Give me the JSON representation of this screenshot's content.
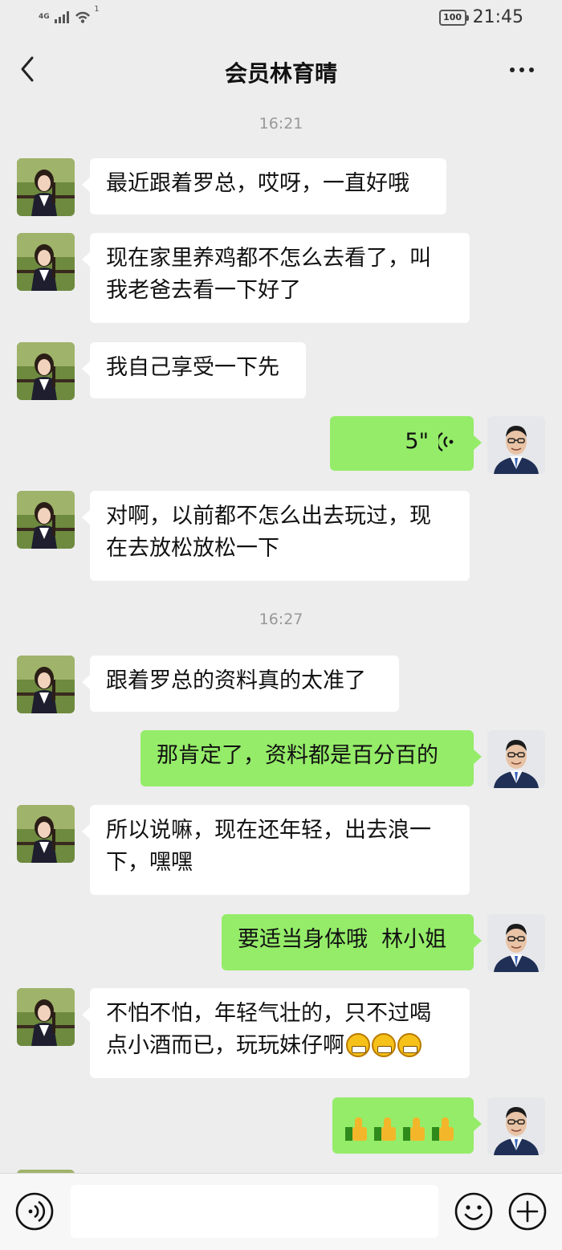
{
  "status_bar": {
    "network": "4G",
    "wifi_sup": "1",
    "battery": "100",
    "time": "21:45"
  },
  "header": {
    "title": "会员林育晴"
  },
  "timestamps": [
    "16:21",
    "16:27"
  ],
  "messages": [
    {
      "from": "other",
      "text": "最近跟着罗总，哎呀，一直好哦"
    },
    {
      "from": "other",
      "lines": [
        "现在家里养鸡都不怎么去看了，叫",
        "我老爸去看一下好了"
      ]
    },
    {
      "from": "other",
      "text": "我自己享受一下先"
    },
    {
      "from": "me",
      "type": "voice",
      "duration": "5\""
    },
    {
      "from": "other",
      "lines": [
        "对啊，以前都不怎么出去玩过，现",
        "在去放松放松一下"
      ]
    },
    {
      "from": "other",
      "text": "跟着罗总的资料真的太准了"
    },
    {
      "from": "me",
      "text": "那肯定了，资料都是百分百的"
    },
    {
      "from": "other",
      "lines": [
        "所以说嘛，现在还年轻，出去浪一",
        "下，嘿嘿"
      ]
    },
    {
      "from": "me",
      "text": "要适当身体哦  林小姐"
    },
    {
      "from": "other",
      "lines": [
        "不怕不怕，年轻气壮的，只不过喝",
        "点小酒而已，玩玩妹仔啊"
      ],
      "emoji": [
        "grin",
        "grin",
        "grin"
      ]
    },
    {
      "from": "me",
      "emoji": [
        "thumbs-up",
        "thumbs-up",
        "thumbs-up",
        "thumbs-up"
      ]
    }
  ],
  "colors": {
    "background": "#ededed",
    "my_bubble": "#95ec69",
    "their_bubble": "#ffffff"
  }
}
